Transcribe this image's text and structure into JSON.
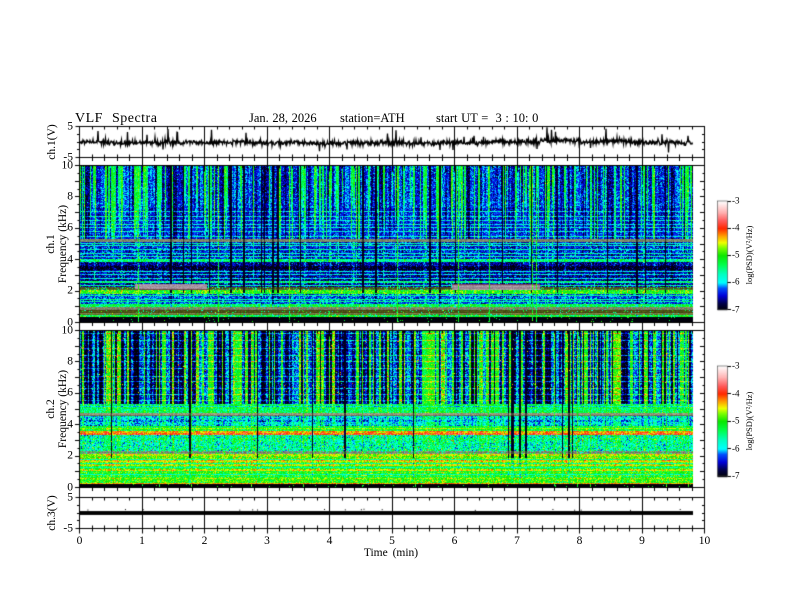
{
  "header": {
    "title": "VLF Spectra",
    "date": "Jan. 28, 2026",
    "station": "station=ATH",
    "start_ut": "start UT =  3 : 10: 0"
  },
  "xaxis": {
    "label": "Time (min)",
    "ticks": [
      "0",
      "1",
      "2",
      "3",
      "4",
      "5",
      "6",
      "7",
      "8",
      "9",
      "10"
    ],
    "range_min": [
      0,
      10
    ],
    "minutes_per_major_tick": 1,
    "minor_ticks_per_major": 5
  },
  "colorbar": {
    "label": "log(PSD)(V²/Hz)",
    "ticks": [
      "-3",
      "-4",
      "-5",
      "-6",
      "-7"
    ],
    "value_range": [
      -7,
      -3
    ]
  },
  "colormap": {
    "stops": [
      [
        0.0,
        "#000008"
      ],
      [
        0.06,
        "#00004a"
      ],
      [
        0.13,
        "#0000d8"
      ],
      [
        0.2,
        "#0050ff"
      ],
      [
        0.25,
        "#00ffff"
      ],
      [
        0.33,
        "#00ffc0"
      ],
      [
        0.42,
        "#00ff48"
      ],
      [
        0.5,
        "#0ae800"
      ],
      [
        0.57,
        "#7aff00"
      ],
      [
        0.62,
        "#f0ff00"
      ],
      [
        0.68,
        "#ffa000"
      ],
      [
        0.75,
        "#ff2800"
      ],
      [
        0.82,
        "#ff5a5a"
      ],
      [
        0.9,
        "#ffb4b4"
      ],
      [
        1.0,
        "#ffffff"
      ]
    ]
  },
  "chart_data": [
    {
      "id": "ch1_wave",
      "type": "line",
      "ylabel": "ch.1(V)",
      "ylim": [
        -5,
        5
      ],
      "ytick_labels": [
        "5",
        "-5"
      ],
      "ytick_values": [
        5,
        -5
      ],
      "data_end_min": 9.8,
      "seed": 101,
      "signal": {
        "mean": 0,
        "noise_sd": 0.42,
        "wander": 0.25,
        "spikes": {
          "count": 36,
          "pos_max": 4.3,
          "neg_max": -3.4,
          "pos_frac": 0.6,
          "min_amp": 1.2
        }
      }
    },
    {
      "id": "ch1_spec",
      "type": "heatmap",
      "ylabel_lines": [
        "ch.1",
        "Frequency (kHz)"
      ],
      "ylim_khz": [
        0,
        10
      ],
      "ytick_labels": [
        "10",
        "8",
        "6",
        "4",
        "2",
        "0"
      ],
      "ytick_values": [
        10,
        8,
        6,
        4,
        2,
        0
      ],
      "value_range": [
        -7,
        -3
      ],
      "data_end_min": 9.8,
      "seed": 202,
      "streaks": {
        "dropout_p": 0.05,
        "impulse_p": 0.012,
        "bright_p": 0.36,
        "bright_len": 1.9,
        "bright_dv": [
          0.58,
          0.35
        ],
        "base_dv": [
          -0.45,
          0.55
        ],
        "dropout_dv": -1.6,
        "smooth": 0.55,
        "mult": 1.3,
        "dropout_fmin": 1.9
      },
      "bands": [
        {
          "f": [
            0.0,
            0.36
          ],
          "base": -7.05,
          "noise": 0.07,
          "streak": 0.0,
          "dots": {
            "p": 0.02,
            "v": -5.1,
            "sd": 0.15
          }
        },
        {
          "f": [
            0.36,
            0.54
          ],
          "base": -5.2,
          "noise": 0.3,
          "streak": 0.12,
          "row_jitter": 0.15
        },
        {
          "f": [
            0.54,
            0.8
          ],
          "mode": "mix",
          "streak": 0.1,
          "green_speckle": 0.08,
          "rows": [
            "#666b2a",
            "#7d7d49",
            "#4e5816",
            "#6d7238",
            "#42480f"
          ]
        },
        {
          "f": [
            0.8,
            1.04
          ],
          "mode": "mix",
          "streak": 0.1,
          "green_speckle": 0.05,
          "rows": [
            "#85856f",
            "#8f8a77",
            "#757560",
            "#828268"
          ]
        },
        {
          "f": [
            1.04,
            1.18
          ],
          "base": -5.35,
          "noise": 0.28,
          "streak": 0.12
        },
        {
          "f": [
            1.18,
            1.84
          ],
          "base": -6.25,
          "noise": 0.25,
          "streak": 0.3,
          "fade": true,
          "hline_spacing": 0.22,
          "hline_v": -5.55
        },
        {
          "f": [
            1.84,
            2.08
          ],
          "base": -5.0,
          "noise": 0.28,
          "streak": 0.15
        },
        {
          "f": [
            2.08,
            2.3
          ],
          "mode": "mix",
          "streak": 0.1,
          "green_speckle": 0.22,
          "rows": [
            "#5f6428",
            "#6a7030",
            "#49511e",
            "#777d45"
          ]
        },
        {
          "f": [
            2.3,
            2.52
          ],
          "base": -6.55,
          "noise": 0.28,
          "streak": 0.2,
          "hlines": [
            {
              "f": 2.42,
              "v": -5.6
            }
          ]
        },
        {
          "f": [
            2.52,
            2.66
          ],
          "base": -5.55,
          "noise": 0.25,
          "streak": 0.12
        },
        {
          "f": [
            2.66,
            3.88
          ],
          "base": -6.6,
          "noise": 0.25,
          "streak": 0.4,
          "fade": true,
          "sub": [
            {
              "f": [
                3.38,
                3.64
              ],
              "base": -6.92
            }
          ],
          "hlines": [
            {
              "f": 2.82,
              "v": -5.85
            },
            {
              "f": 3.06,
              "v": -5.9
            },
            {
              "f": 3.3,
              "v": -5.85
            }
          ]
        },
        {
          "f": [
            3.88,
            4.1
          ],
          "base": -5.5,
          "noise": 0.3,
          "streak": 0.15
        },
        {
          "f": [
            4.1,
            5.16
          ],
          "base": -6.4,
          "noise": 0.25,
          "streak": 0.45,
          "fade": true,
          "hline_spacing": 0.21,
          "hline_v": -5.7
        },
        {
          "f": [
            5.16,
            5.36
          ],
          "mode": "mix",
          "streak": 0.12,
          "rows": [
            "#7d8a68",
            "#93a07e",
            "#6a7a52",
            "#86937a"
          ]
        },
        {
          "f": [
            5.36,
            7.32
          ],
          "base": -6.35,
          "noise": 0.2,
          "streak": 1.0,
          "fade": "cut",
          "hline_spacing": 0.28,
          "hline_v": -5.8
        },
        {
          "f": [
            7.32,
            10.0
          ],
          "base": -6.2,
          "noise": 0.22,
          "streak": 1.0,
          "fade": "cut"
        }
      ],
      "segments": [
        {
          "x_min": [
            0.88,
            2.02
          ],
          "f": [
            2.12,
            2.46
          ],
          "rows": [
            "#9a8795",
            "#ab9aa6",
            "#a18d9b",
            "#8d7a88"
          ],
          "darkline": "#7a4050"
        },
        {
          "x_min": [
            5.95,
            7.35
          ],
          "f": [
            2.12,
            2.46
          ],
          "rows": [
            "#9a8795",
            "#ab9aa6",
            "#a18d9b",
            "#8d7a88"
          ],
          "darkline": "#7a4050"
        }
      ]
    },
    {
      "id": "ch2_spec",
      "type": "heatmap",
      "ylabel_lines": [
        "ch.2",
        "Frequency (kHz)"
      ],
      "ylim_khz": [
        0,
        10
      ],
      "ytick_labels": [
        "10",
        "8",
        "6",
        "4",
        "2",
        "0"
      ],
      "ytick_values": [
        10,
        8,
        6,
        4,
        2,
        0
      ],
      "value_range": [
        -7,
        -3
      ],
      "data_end_min": 9.8,
      "seed": 303,
      "streaks": {
        "dropout_p": 0.05,
        "impulse_p": 0.02,
        "bright_p": 0.33,
        "dark_p": 0.65,
        "bright_dv": [
          0.68,
          0.3
        ],
        "dark_dv": [
          -0.45,
          -0.35
        ],
        "base_dv": [
          -0.25,
          0.3
        ],
        "dropout_dv": -1.5,
        "smooth": 0.5,
        "mult": 1.3,
        "dropout_fmin": 1.9
      },
      "bands": [
        {
          "f": [
            0.0,
            0.3
          ],
          "base": -7.05,
          "noise": 0.05,
          "streak": 0.0,
          "dots": {
            "p": 0.02,
            "v": -5.1,
            "sd": 0.15
          },
          "hlines": [
            {
              "f": 0.27,
              "v": -4.3
            }
          ]
        },
        {
          "f": [
            0.3,
            0.5
          ],
          "base": -5.0,
          "noise": 0.3,
          "streak": 0.1,
          "row_jitter": 0.3
        },
        {
          "f": [
            0.5,
            0.66
          ],
          "base": -4.65,
          "noise": 0.25,
          "streak": 0.05,
          "row_jitter": 0.3
        },
        {
          "f": [
            0.66,
            1.06
          ],
          "base": -5.15,
          "noise": 0.3,
          "streak": 0.08,
          "row_jitter": 0.35,
          "hlines": [
            {
              "f": 0.85,
              "v": -5.7
            }
          ]
        },
        {
          "f": [
            1.06,
            2.02
          ],
          "base": -4.85,
          "noise": 0.3,
          "streak": 0.1,
          "row_jitter": 0.45,
          "hlines": [
            {
              "f": 1.3,
              "v": -5.6
            },
            {
              "f": 1.55,
              "v": -5.65
            },
            {
              "f": 1.8,
              "v": -5.6
            },
            {
              "f": 1.14,
              "v": -4.5
            },
            {
              "f": 1.44,
              "v": -4.55
            },
            {
              "f": 1.7,
              "v": -4.5
            }
          ]
        },
        {
          "f": [
            2.02,
            2.14
          ],
          "base": -4.6,
          "noise": 0.22,
          "streak": 0.05
        },
        {
          "f": [
            2.14,
            2.34
          ],
          "mode": "mix",
          "streak": 0.1,
          "green_speckle": 0.25,
          "rows": [
            "#8a8a7a",
            "#9a948c",
            "#7a7a68",
            "#8f8a80"
          ]
        },
        {
          "f": [
            2.34,
            3.38
          ],
          "base": -5.55,
          "noise": 0.35,
          "streak": 0.18,
          "row_jitter": 0.15,
          "dots": {
            "p": 0.012,
            "v": -4.35
          }
        },
        {
          "f": [
            3.38,
            3.62
          ],
          "base": -4.2,
          "noise": 0.25,
          "streak": 0.05,
          "wavy": 0.18,
          "row_jitter": 0.2
        },
        {
          "f": [
            3.62,
            3.96
          ],
          "base": -5.25,
          "noise": 0.28,
          "streak": 0.1,
          "row_jitter": 0.2,
          "hlines": [
            {
              "f": 3.8,
              "v": -4.7
            }
          ]
        },
        {
          "f": [
            3.96,
            4.58
          ],
          "base": -5.9,
          "noise": 0.3,
          "streak": 0.25,
          "row_jitter": 0.2
        },
        {
          "f": [
            4.58,
            4.78
          ],
          "mode": "mix",
          "streak": 0.1,
          "rows": [
            "#8a8a6a",
            "#6f7450",
            "#97977d",
            "#7d8060"
          ]
        },
        {
          "f": [
            4.78,
            5.36
          ],
          "base": -5.3,
          "noise": 0.28,
          "streak": 0.15,
          "row_jitter": 0.2,
          "hlines": [
            {
              "f": 5.2,
              "v": -5.95
            }
          ]
        },
        {
          "f": [
            5.36,
            10.0
          ],
          "base": -6.1,
          "noise": 0.24,
          "streak": 1.0,
          "hline_spacing": 0.4,
          "hline_v": -5.5,
          "dots": {
            "p": 0.008,
            "v": -4.35,
            "f_range": [
              6.0,
              9.6
            ]
          }
        }
      ],
      "segments": []
    },
    {
      "id": "ch3_wave",
      "type": "line",
      "ylabel": "ch.3(V)",
      "ylim": [
        -5,
        5
      ],
      "ytick_labels": [
        "5",
        "-5"
      ],
      "ytick_values": [
        5,
        -5
      ],
      "data_end_min": 9.8,
      "seed": 404,
      "signal": {
        "mean": 0,
        "flat": true,
        "half_thickness_v": 0.62
      }
    }
  ]
}
